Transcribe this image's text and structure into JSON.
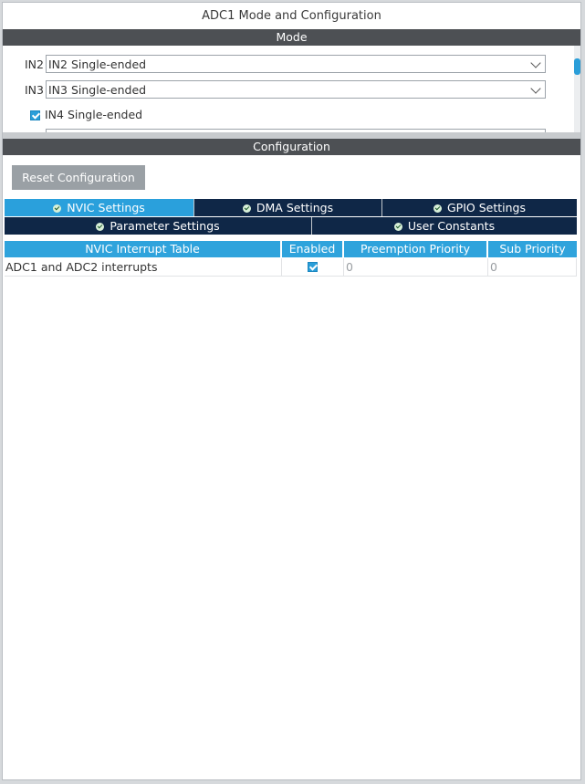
{
  "window": {
    "title": "ADC1 Mode and Configuration"
  },
  "mode": {
    "header": "Mode",
    "rows": [
      {
        "label": "IN2",
        "value": "IN2 Single-ended"
      },
      {
        "label": "IN3",
        "value": "IN3 Single-ended"
      }
    ],
    "checkbox": {
      "label": "IN4 Single-ended",
      "checked": true
    }
  },
  "configuration": {
    "header": "Configuration",
    "reset_label": "Reset Configuration",
    "tabs_row1": [
      "NVIC Settings",
      "DMA Settings",
      "GPIO Settings"
    ],
    "tabs_row2": [
      "Parameter Settings",
      "User Constants"
    ],
    "active_tab": "NVIC Settings",
    "table": {
      "columns": [
        "NVIC Interrupt Table",
        "Enabled",
        "Preemption Priority",
        "Sub Priority"
      ],
      "rows": [
        {
          "name": "ADC1 and ADC2 interrupts",
          "enabled": true,
          "preemption": "0",
          "sub": "0"
        }
      ]
    }
  },
  "colors": {
    "accent": "#2aa0dc",
    "tab_dark": "#0f2747",
    "section_bar": "#4d5054",
    "reset_button": "#9aa0a5"
  }
}
